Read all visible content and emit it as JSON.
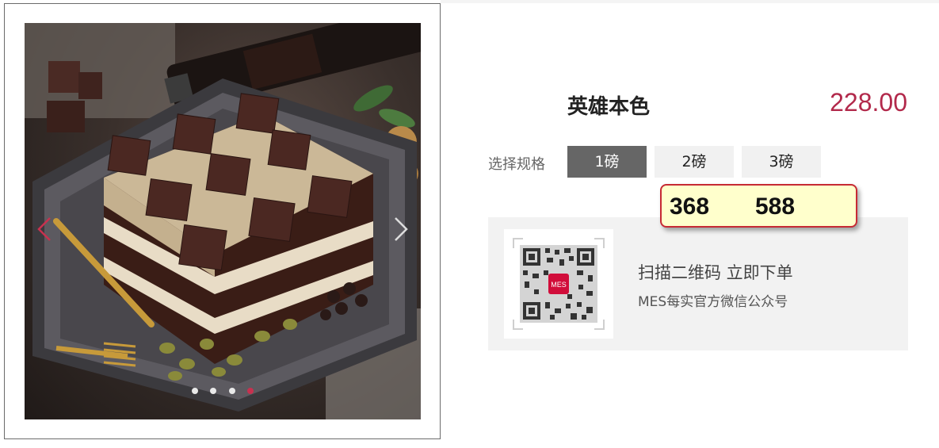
{
  "product": {
    "title": "英雄本色",
    "price": "228.00"
  },
  "spec": {
    "label": "选择规格",
    "options": [
      "1磅",
      "2磅",
      "3磅"
    ],
    "selected_index": 0
  },
  "tooltip": {
    "values": [
      "368",
      "588"
    ]
  },
  "qr": {
    "badge": "MES",
    "line1": "扫描二维码 立即下单",
    "line2": "MES每实官方微信公众号"
  },
  "carousel": {
    "slide_count": 4,
    "active_index": 3
  },
  "icons": {
    "prev": "chevron-left-icon",
    "next": "chevron-right-icon"
  },
  "colors": {
    "accent": "#b2294b",
    "active_dot": "#c7314f",
    "selected_spec": "#666666",
    "tooltip_bg": "#ffffcc",
    "tooltip_border": "#c72a34"
  }
}
